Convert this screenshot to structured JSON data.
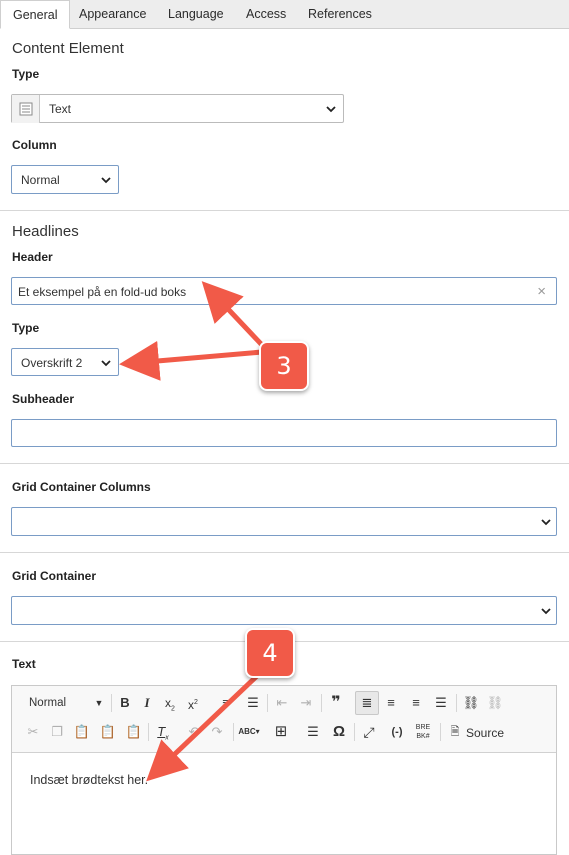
{
  "tabs": [
    "General",
    "Appearance",
    "Language",
    "Access",
    "References"
  ],
  "content_element": {
    "title": "Content Element",
    "type_label": "Type",
    "type_value": "Text",
    "column_label": "Column",
    "column_value": "Normal"
  },
  "headlines": {
    "title": "Headlines",
    "header_label": "Header",
    "header_value": "Et eksempel på en fold-ud boks",
    "clear_glyph": "×",
    "type_label": "Type",
    "type_value": "Overskrift 2",
    "subheader_label": "Subheader",
    "subheader_value": ""
  },
  "grid_columns": {
    "label": "Grid Container Columns",
    "value": ""
  },
  "grid_container": {
    "label": "Grid Container",
    "value": ""
  },
  "text": {
    "label": "Text",
    "format_select": "Normal",
    "source_label": "Source",
    "body": "Indsæt brødtekst her."
  },
  "callouts": [
    "3",
    "4"
  ],
  "colors": {
    "accent": "#f15a48",
    "border_blue": "#7a9cc6"
  }
}
